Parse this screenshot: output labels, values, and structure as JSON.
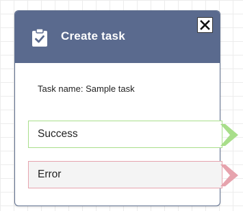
{
  "block": {
    "title": "Create task",
    "icon": "clipboard-check-icon",
    "close_icon": "close-icon",
    "task_name": "Task name: Sample task"
  },
  "branches": [
    {
      "label": "Success",
      "color": "#a8de8a"
    },
    {
      "label": "Error",
      "color": "#e6a3ad"
    }
  ],
  "colors": {
    "header": "#5a6a8e",
    "entry_arrow": "#7a7a7a"
  }
}
